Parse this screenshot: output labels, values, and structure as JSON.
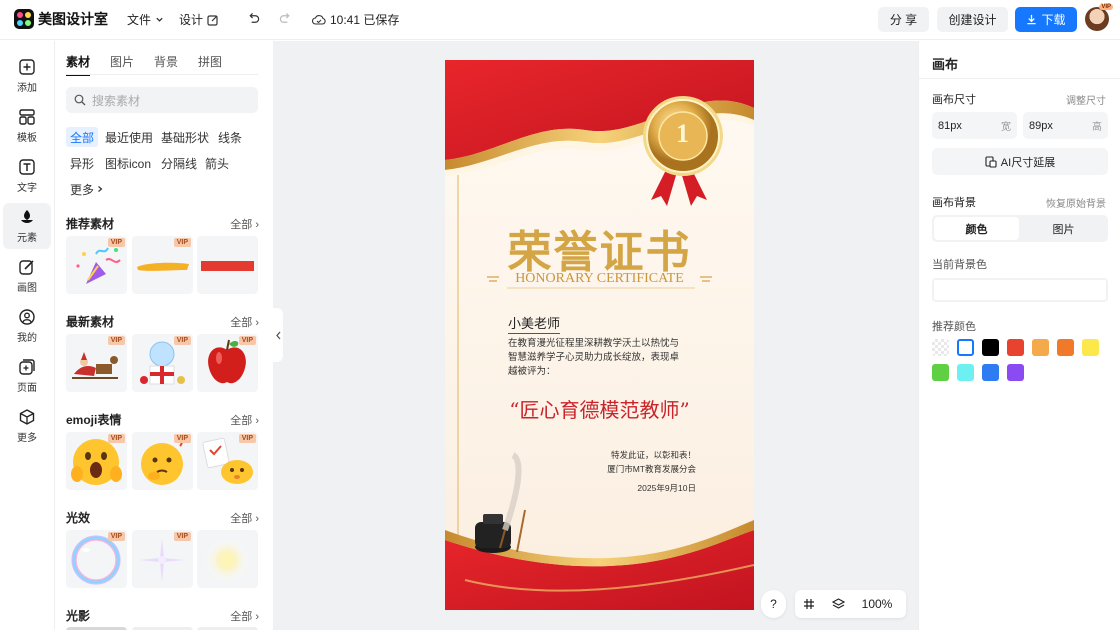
{
  "app": {
    "name": "美图设计室"
  },
  "toolbar": {
    "file_label": "文件",
    "design_label": "设计",
    "save_status": "10:41 已保存",
    "share_label": "分 享",
    "create_label": "创建设计",
    "download_label": "下载",
    "avatar_badge": "VIP"
  },
  "leftnav": {
    "items": [
      {
        "label": "添加",
        "icon": "plus-square-icon"
      },
      {
        "label": "模板",
        "icon": "template-icon"
      },
      {
        "label": "文字",
        "icon": "text-icon"
      },
      {
        "label": "元素",
        "icon": "shapes-icon"
      },
      {
        "label": "画图",
        "icon": "draw-icon"
      },
      {
        "label": "我的",
        "icon": "user-icon"
      },
      {
        "label": "页面",
        "icon": "page-add-icon"
      },
      {
        "label": "更多",
        "icon": "cube-icon"
      }
    ]
  },
  "panel": {
    "tabs": [
      "素材",
      "图片",
      "背景",
      "拼图"
    ],
    "search_placeholder": "搜索素材",
    "chips": [
      "全部",
      "最近使用",
      "基础形状",
      "线条",
      "异形",
      "图标icon",
      "分隔线",
      "箭头",
      "更多"
    ],
    "sections": [
      {
        "title": "推荐素材",
        "all": "全部"
      },
      {
        "title": "最新素材",
        "all": "全部"
      },
      {
        "title": "emoji表情",
        "all": "全部"
      },
      {
        "title": "光效",
        "all": "全部"
      },
      {
        "title": "光影",
        "all": "全部"
      }
    ],
    "vip_label": "VIP"
  },
  "certificate": {
    "medal_number": "1",
    "title_cn": "荣誉证书",
    "title_en": "HONORARY CERTIFICATE",
    "recipient": "小美老师",
    "body": [
      "在教育漫光征程里深耕教学沃土以热忱与",
      "智慧滋养学子心灵助力成长绽放，表现卓",
      "越被评为："
    ],
    "award": "“匠心育德模范教师”",
    "sign_lines": [
      "特发此证，以彰和表！",
      "厦门市MT教育发展分会"
    ],
    "date": "2025年9月10日"
  },
  "canvas_tools": {
    "help": "?",
    "zoom": "100%"
  },
  "rightpanel": {
    "title": "画布",
    "size_label": "画布尺寸",
    "adjust_size": "调整尺寸",
    "width_value": "81px",
    "width_unit": "宽",
    "height_value": "89px",
    "height_unit": "高",
    "ai_extend": "AI尺寸延展",
    "bg_label": "画布背景",
    "restore_bg": "恢复原始背景",
    "bg_tabs": [
      "颜色",
      "图片"
    ],
    "current_bg_label": "当前背景色",
    "recommend_label": "推荐颜色",
    "colors": [
      "transparent",
      "#ffffff",
      "#000000",
      "#e8432e",
      "#f4a94a",
      "#f07a2a",
      "#fce84a",
      "#5fcf44",
      "#6ff0f0",
      "#2d7cf2",
      "#8a4cf2"
    ]
  },
  "colors": {
    "accent": "#1677ff",
    "cert_red": "#d62a2a",
    "gold": "#d4a545"
  }
}
